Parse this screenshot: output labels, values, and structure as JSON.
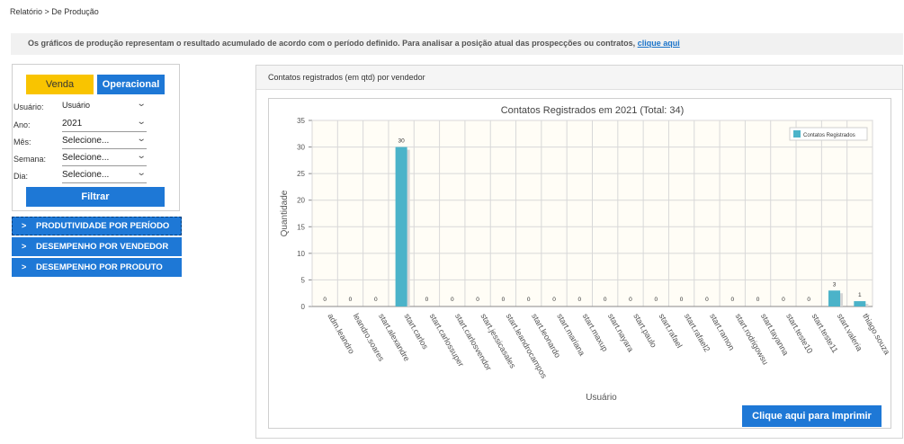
{
  "breadcrumb": "Relatório > De Produção",
  "info": {
    "text": "Os gráficos de produção representam o resultado acumulado de acordo com o período definido. Para analisar a posição atual das prospecções ou contratos,",
    "link": "clique aqui"
  },
  "tabs": {
    "venda": "Venda",
    "operacional": "Operacional"
  },
  "filters": {
    "usuario": {
      "label": "Usuário:",
      "value": "Usuário"
    },
    "ano": {
      "label": "Ano:",
      "value": "2021"
    },
    "mes": {
      "label": "Mês:",
      "value": "Selecione..."
    },
    "semana": {
      "label": "Semana:",
      "value": "Selecione..."
    },
    "dia": {
      "label": "Dia:",
      "value": "Selecione..."
    }
  },
  "filter_button": "Filtrar",
  "accordion": [
    "PRODUTIVIDADE POR PERÍODO",
    "DESEMPENHO POR VENDEDOR",
    "DESEMPENHO POR PRODUTO"
  ],
  "panel_title": "Contatos registrados (em qtd) por vendedor",
  "print_button": "Clique aqui para Imprimir",
  "colors": {
    "bar": "#4bb3c9",
    "bar_shadow": "#d6d6d6",
    "plot_bg": "#fffdf6",
    "button_blue": "#1e78d6",
    "button_yellow": "#f9c400"
  },
  "chart_data": {
    "type": "bar",
    "title": "Contatos Registrados em 2021 (Total: 34)",
    "xlabel": "Usuário",
    "ylabel": "Quantidade",
    "ylim": [
      0,
      35
    ],
    "yticks": [
      0,
      5,
      10,
      15,
      20,
      25,
      30,
      35
    ],
    "grid": true,
    "legend_position": "top-right",
    "categories": [
      "adm.leandro",
      "leandro.soares",
      "start.alexandre",
      "start.carlos",
      "start.carlossuper",
      "start.carlosvendor",
      "start.jessicasales",
      "start.leandrocampos",
      "start.leonardo",
      "start.mariana",
      "start.maxup",
      "start.nayara",
      "start.paulo",
      "start.rafael",
      "start.rafael2",
      "start.ramon",
      "start.rodrigowsu",
      "start.tayanna",
      "start.teste10",
      "start.teste11",
      "start.valeria",
      "thiago.souza"
    ],
    "series": [
      {
        "name": "Contatos Registrados",
        "values": [
          0,
          0,
          0,
          30,
          0,
          0,
          0,
          0,
          0,
          0,
          0,
          0,
          0,
          0,
          0,
          0,
          0,
          0,
          0,
          0,
          3,
          1
        ]
      }
    ]
  }
}
